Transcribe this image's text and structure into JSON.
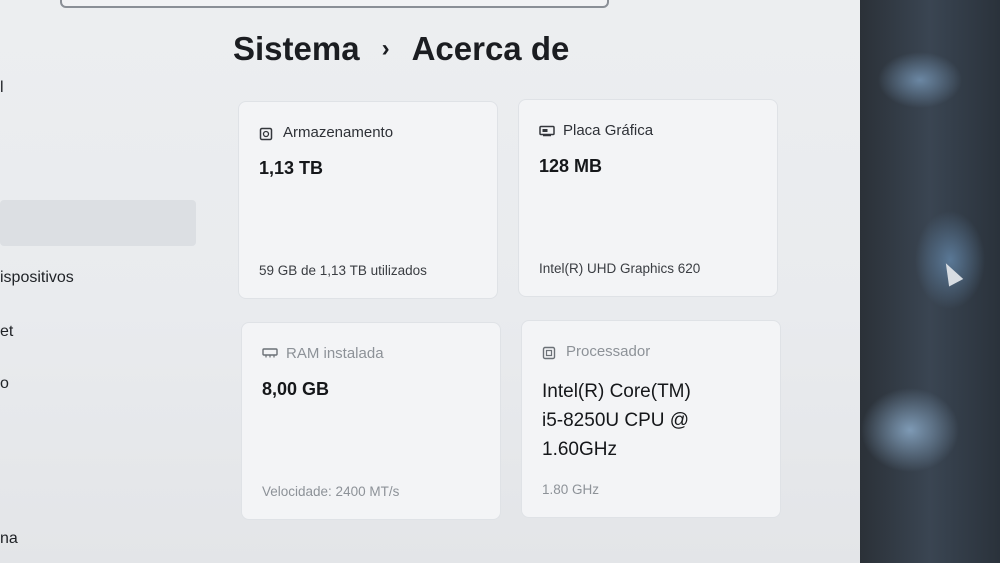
{
  "breadcrumb": {
    "parent": "Sistema",
    "current": "Acerca de"
  },
  "sidebar": {
    "items": [
      "l",
      "ispositivos",
      "et",
      "o",
      "na"
    ]
  },
  "cards": {
    "storage": {
      "icon": "hard-drive-icon",
      "label": "Armazenamento",
      "value": "1,13 TB",
      "detail": "59 GB de 1,13 TB utilizados"
    },
    "gpu": {
      "icon": "graphics-card-icon",
      "label": "Placa Gráfica",
      "value": "128 MB",
      "detail": "Intel(R) UHD Graphics 620"
    },
    "ram": {
      "icon": "memory-icon",
      "label": "RAM instalada",
      "value": "8,00 GB",
      "detail": "Velocidade: 2400 MT/s"
    },
    "cpu": {
      "icon": "processor-icon",
      "label": "Processador",
      "value_lines": [
        "Intel(R) Core(TM)",
        "i5-8250U CPU @",
        "1.60GHz"
      ],
      "detail": "1.80 GHz"
    }
  }
}
